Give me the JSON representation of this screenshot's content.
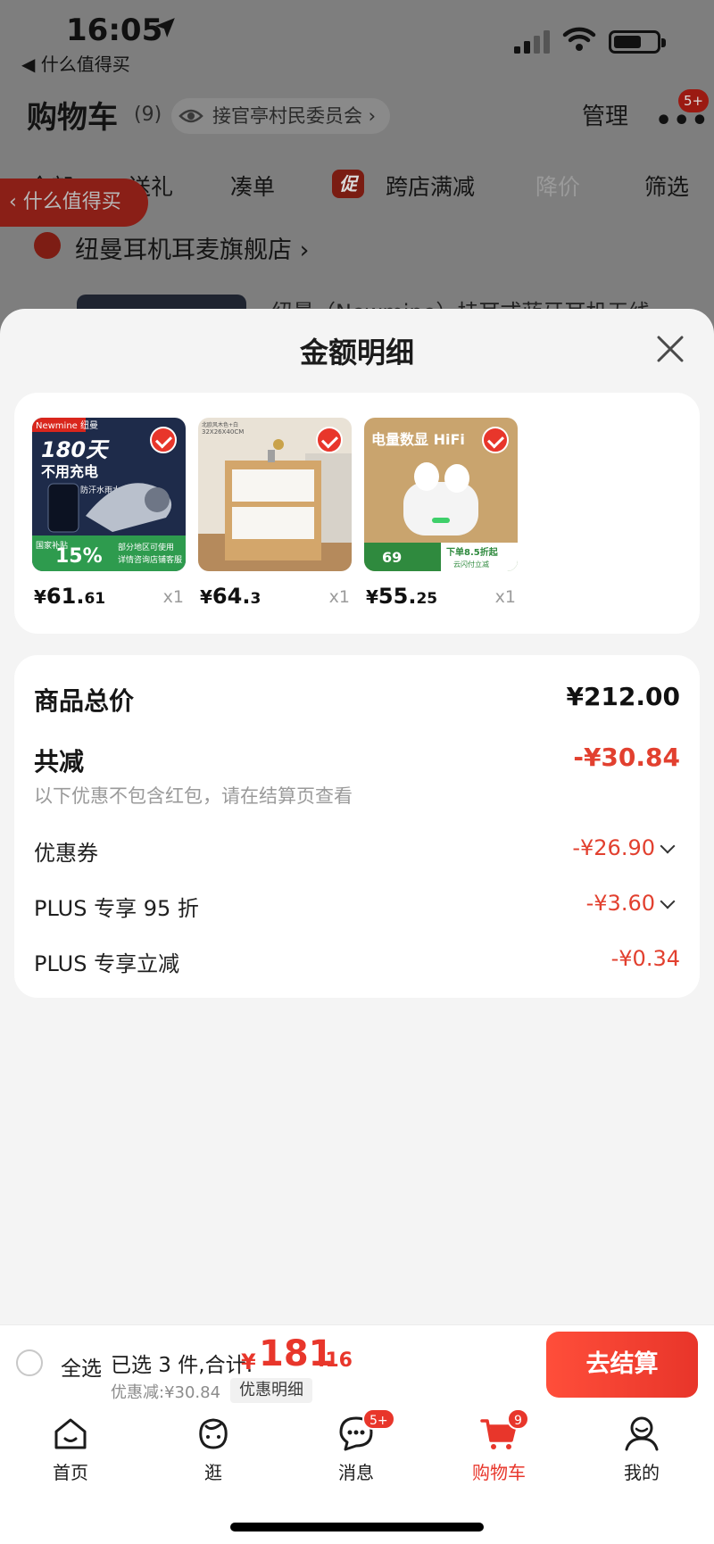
{
  "status_bar": {
    "time": "16:05",
    "back_app": "◀ 什么值得买"
  },
  "cart_header": {
    "title": "购物车",
    "count": "(9)",
    "address": "接官亭村民委员会 ›",
    "manage": "管理",
    "more_badge": "5+"
  },
  "filter_tabs": [
    "全部",
    "送礼",
    "凑单",
    "跨店满减",
    "降价",
    "筛选"
  ],
  "promo_badge": "促",
  "float_back": "‹ 什么值得买",
  "store": {
    "name": "纽曼耳机耳麦旗舰店 ›"
  },
  "bg_product_title": "纽曼（Newmine）挂耳式蓝牙耳机无线",
  "modal": {
    "title": "金额明细",
    "products": [
      {
        "name": "纽曼挂耳蓝牙耳机",
        "price_int": "61.",
        "price_dec": "61",
        "qty": "x1",
        "img_texts": [
          "Newmine 纽曼",
          "180天",
          "不用充电",
          "防汗水雨水",
          "国家补贴",
          "15%",
          "部分地区可使用",
          "详情咨询店铺客服"
        ]
      },
      {
        "name": "床头柜",
        "price_int": "64.",
        "price_dec": "3",
        "qty": "x1",
        "img_texts": [
          "32X26X40CM",
          "北欧风木色+白"
        ]
      },
      {
        "name": "蓝牙耳机",
        "price_int": "55.",
        "price_dec": "25",
        "qty": "x1",
        "img_texts": [
          "电量数显 HiFi",
          "69",
          "下单8.5折起",
          "云闪付立减"
        ]
      }
    ],
    "summary": {
      "total_label": "商品总价",
      "total_value": "¥212.00",
      "reduce_label": "共减",
      "reduce_value": "-¥30.84",
      "note": "以下优惠不包含红包，请在结算页查看",
      "items": [
        {
          "label": "优惠券",
          "value": "-¥26.90",
          "expandable": true
        },
        {
          "label": "PLUS 专享 95 折",
          "value": "-¥3.60",
          "expandable": true
        },
        {
          "label": "PLUS 专享立减",
          "value": "-¥0.34",
          "expandable": false
        }
      ]
    }
  },
  "bottom_bar": {
    "select_all": "全选",
    "selected": "已选 3 件,合计:",
    "total_yen": "¥",
    "total_int": "181",
    "total_dec": ".16",
    "discount": "优惠减:¥30.84",
    "detail_link": "优惠明细",
    "checkout": "去结算"
  },
  "tabbar": [
    {
      "label": "首页",
      "icon": "home-icon"
    },
    {
      "label": "逛",
      "icon": "browse-icon"
    },
    {
      "label": "消息",
      "icon": "message-icon",
      "badge": "5+"
    },
    {
      "label": "购物车",
      "icon": "cart-icon",
      "badge": "9",
      "active": true
    },
    {
      "label": "我的",
      "icon": "profile-icon"
    }
  ],
  "colors": {
    "accent": "#e8362b",
    "sheet_bg": "#f4f4f4",
    "overlay": "#7d7d7d"
  }
}
